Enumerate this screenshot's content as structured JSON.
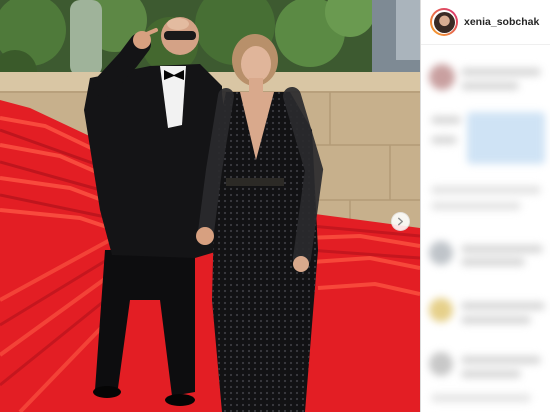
{
  "post": {
    "username": "xenia_sobchak",
    "avatar_icon": "profile-avatar",
    "carousel_next_icon": "chevron-right-icon"
  },
  "colors": {
    "avatar_ring_start": "#f9a825",
    "avatar_ring_end": "#d62976",
    "divider": "#dbdbdb"
  }
}
